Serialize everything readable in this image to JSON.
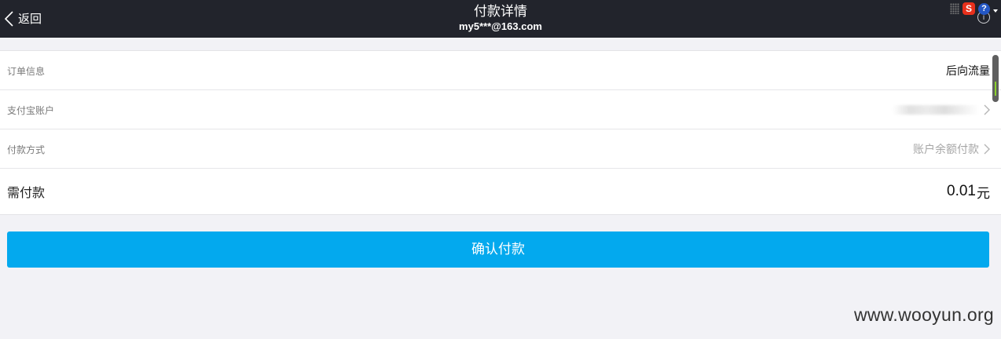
{
  "header": {
    "back_label": "返回",
    "title": "付款详情",
    "subtitle": "my5***@163.com",
    "info_icon": "info-icon",
    "tray_s": "S",
    "tray_help": "?"
  },
  "rows": [
    {
      "label": "订单信息",
      "value": "后向流量"
    },
    {
      "label": "支付宝账户",
      "value": ""
    },
    {
      "label": "付款方式",
      "value": "账户余额付款"
    },
    {
      "label": "需付款",
      "amount": "0.01",
      "unit": "元"
    }
  ],
  "confirm_button": "确认付款",
  "watermark": "www.wooyun.org",
  "colors": {
    "header_bg": "#22242c",
    "page_bg": "#f2f2f6",
    "primary_button": "#03a9ee"
  }
}
